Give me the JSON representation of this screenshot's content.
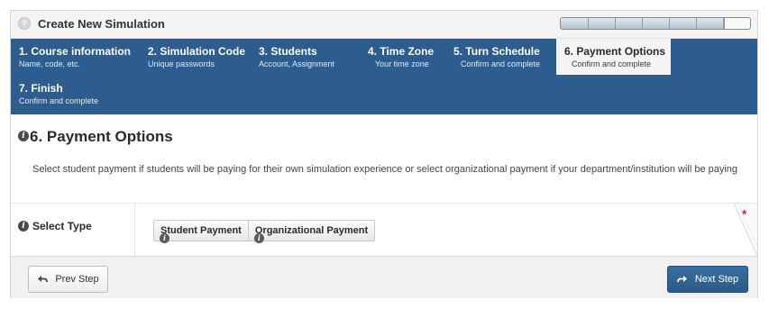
{
  "window": {
    "title": "Create New Simulation",
    "title_icon": "question-icon",
    "progress_fraction": 0.86,
    "progress_segments": 7
  },
  "steps": [
    {
      "title": "1. Course information",
      "subtitle": "Name, code, etc.",
      "active": false
    },
    {
      "title": "2. Simulation Code",
      "subtitle": "Unique passwords",
      "active": false
    },
    {
      "title": "3. Students",
      "subtitle": "Account, Assignment",
      "active": false
    },
    {
      "title": "4. Time Zone",
      "subtitle": "Your time zone",
      "active": false
    },
    {
      "title": "5. Turn Schedule",
      "subtitle": "Confirm and complete",
      "active": false
    },
    {
      "title": "6. Payment Options",
      "subtitle": "Confirm and complete",
      "active": true
    },
    {
      "title": "7. Finish",
      "subtitle": "Confirm and complete",
      "active": false
    }
  ],
  "section": {
    "title": "6. Payment Options",
    "description": "Select student payment if students will be paying for their own simulation experience or select organizational payment if your department/institution will be paying"
  },
  "select_type": {
    "label": "Select Type",
    "options": [
      "Student Payment",
      "Organizational Payment"
    ],
    "required_marker": "*"
  },
  "footer": {
    "prev_label": "Prev Step",
    "next_label": "Next Step"
  },
  "colors": {
    "nav_background": "#2d5d8e",
    "active_step_background": "#f4f4f4",
    "next_button": "#2a5b8a",
    "required": "#cc2222"
  }
}
